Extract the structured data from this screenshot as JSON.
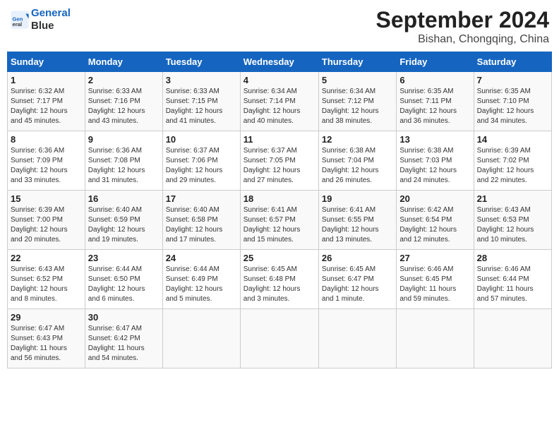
{
  "header": {
    "logo_line1": "General",
    "logo_line2": "Blue",
    "title": "September 2024",
    "subtitle": "Bishan, Chongqing, China"
  },
  "calendar": {
    "days_of_week": [
      "Sunday",
      "Monday",
      "Tuesday",
      "Wednesday",
      "Thursday",
      "Friday",
      "Saturday"
    ],
    "weeks": [
      [
        {
          "day": "",
          "info": ""
        },
        {
          "day": "2",
          "info": "Sunrise: 6:33 AM\nSunset: 7:16 PM\nDaylight: 12 hours\nand 43 minutes."
        },
        {
          "day": "3",
          "info": "Sunrise: 6:33 AM\nSunset: 7:15 PM\nDaylight: 12 hours\nand 41 minutes."
        },
        {
          "day": "4",
          "info": "Sunrise: 6:34 AM\nSunset: 7:14 PM\nDaylight: 12 hours\nand 40 minutes."
        },
        {
          "day": "5",
          "info": "Sunrise: 6:34 AM\nSunset: 7:12 PM\nDaylight: 12 hours\nand 38 minutes."
        },
        {
          "day": "6",
          "info": "Sunrise: 6:35 AM\nSunset: 7:11 PM\nDaylight: 12 hours\nand 36 minutes."
        },
        {
          "day": "7",
          "info": "Sunrise: 6:35 AM\nSunset: 7:10 PM\nDaylight: 12 hours\nand 34 minutes."
        }
      ],
      [
        {
          "day": "1",
          "info": "Sunrise: 6:32 AM\nSunset: 7:17 PM\nDaylight: 12 hours\nand 45 minutes."
        },
        null,
        null,
        null,
        null,
        null,
        null
      ],
      [
        {
          "day": "8",
          "info": "Sunrise: 6:36 AM\nSunset: 7:09 PM\nDaylight: 12 hours\nand 33 minutes."
        },
        {
          "day": "9",
          "info": "Sunrise: 6:36 AM\nSunset: 7:08 PM\nDaylight: 12 hours\nand 31 minutes."
        },
        {
          "day": "10",
          "info": "Sunrise: 6:37 AM\nSunset: 7:06 PM\nDaylight: 12 hours\nand 29 minutes."
        },
        {
          "day": "11",
          "info": "Sunrise: 6:37 AM\nSunset: 7:05 PM\nDaylight: 12 hours\nand 27 minutes."
        },
        {
          "day": "12",
          "info": "Sunrise: 6:38 AM\nSunset: 7:04 PM\nDaylight: 12 hours\nand 26 minutes."
        },
        {
          "day": "13",
          "info": "Sunrise: 6:38 AM\nSunset: 7:03 PM\nDaylight: 12 hours\nand 24 minutes."
        },
        {
          "day": "14",
          "info": "Sunrise: 6:39 AM\nSunset: 7:02 PM\nDaylight: 12 hours\nand 22 minutes."
        }
      ],
      [
        {
          "day": "15",
          "info": "Sunrise: 6:39 AM\nSunset: 7:00 PM\nDaylight: 12 hours\nand 20 minutes."
        },
        {
          "day": "16",
          "info": "Sunrise: 6:40 AM\nSunset: 6:59 PM\nDaylight: 12 hours\nand 19 minutes."
        },
        {
          "day": "17",
          "info": "Sunrise: 6:40 AM\nSunset: 6:58 PM\nDaylight: 12 hours\nand 17 minutes."
        },
        {
          "day": "18",
          "info": "Sunrise: 6:41 AM\nSunset: 6:57 PM\nDaylight: 12 hours\nand 15 minutes."
        },
        {
          "day": "19",
          "info": "Sunrise: 6:41 AM\nSunset: 6:55 PM\nDaylight: 12 hours\nand 13 minutes."
        },
        {
          "day": "20",
          "info": "Sunrise: 6:42 AM\nSunset: 6:54 PM\nDaylight: 12 hours\nand 12 minutes."
        },
        {
          "day": "21",
          "info": "Sunrise: 6:43 AM\nSunset: 6:53 PM\nDaylight: 12 hours\nand 10 minutes."
        }
      ],
      [
        {
          "day": "22",
          "info": "Sunrise: 6:43 AM\nSunset: 6:52 PM\nDaylight: 12 hours\nand 8 minutes."
        },
        {
          "day": "23",
          "info": "Sunrise: 6:44 AM\nSunset: 6:50 PM\nDaylight: 12 hours\nand 6 minutes."
        },
        {
          "day": "24",
          "info": "Sunrise: 6:44 AM\nSunset: 6:49 PM\nDaylight: 12 hours\nand 5 minutes."
        },
        {
          "day": "25",
          "info": "Sunrise: 6:45 AM\nSunset: 6:48 PM\nDaylight: 12 hours\nand 3 minutes."
        },
        {
          "day": "26",
          "info": "Sunrise: 6:45 AM\nSunset: 6:47 PM\nDaylight: 12 hours\nand 1 minute."
        },
        {
          "day": "27",
          "info": "Sunrise: 6:46 AM\nSunset: 6:45 PM\nDaylight: 11 hours\nand 59 minutes."
        },
        {
          "day": "28",
          "info": "Sunrise: 6:46 AM\nSunset: 6:44 PM\nDaylight: 11 hours\nand 57 minutes."
        }
      ],
      [
        {
          "day": "29",
          "info": "Sunrise: 6:47 AM\nSunset: 6:43 PM\nDaylight: 11 hours\nand 56 minutes."
        },
        {
          "day": "30",
          "info": "Sunrise: 6:47 AM\nSunset: 6:42 PM\nDaylight: 11 hours\nand 54 minutes."
        },
        {
          "day": "",
          "info": ""
        },
        {
          "day": "",
          "info": ""
        },
        {
          "day": "",
          "info": ""
        },
        {
          "day": "",
          "info": ""
        },
        {
          "day": "",
          "info": ""
        }
      ]
    ]
  }
}
